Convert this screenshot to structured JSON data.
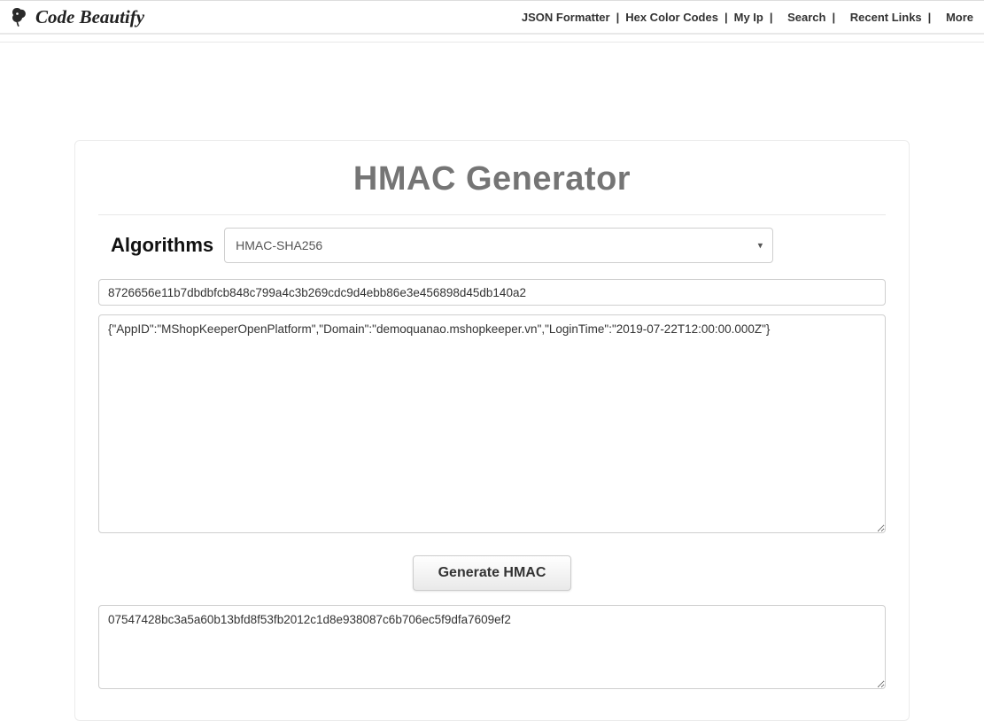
{
  "header": {
    "logo_text": "Code Beautify",
    "nav": {
      "json_formatter": "JSON Formatter",
      "hex_color": "Hex Color Codes",
      "my_ip": "My Ip",
      "search": "Search",
      "recent_links": "Recent Links",
      "more": "More"
    }
  },
  "page": {
    "title": "HMAC Generator",
    "algorithms_label": "Algorithms",
    "algorithm_selected": "HMAC-SHA256",
    "key_value": "8726656e11b7dbdbfcb848c799a4c3b269cdc9d4ebb86e3e456898d45db140a2",
    "message_value": "{\"AppID\":\"MShopKeeperOpenPlatform\",\"Domain\":\"demoquanao.mshopkeeper.vn\",\"LoginTime\":\"2019-07-22T12:00:00.000Z\"}",
    "generate_button": "Generate HMAC",
    "output_value": "07547428bc3a5a60b13bfd8f53fb2012c1d8e938087c6b706ec5f9dfa7609ef2"
  }
}
